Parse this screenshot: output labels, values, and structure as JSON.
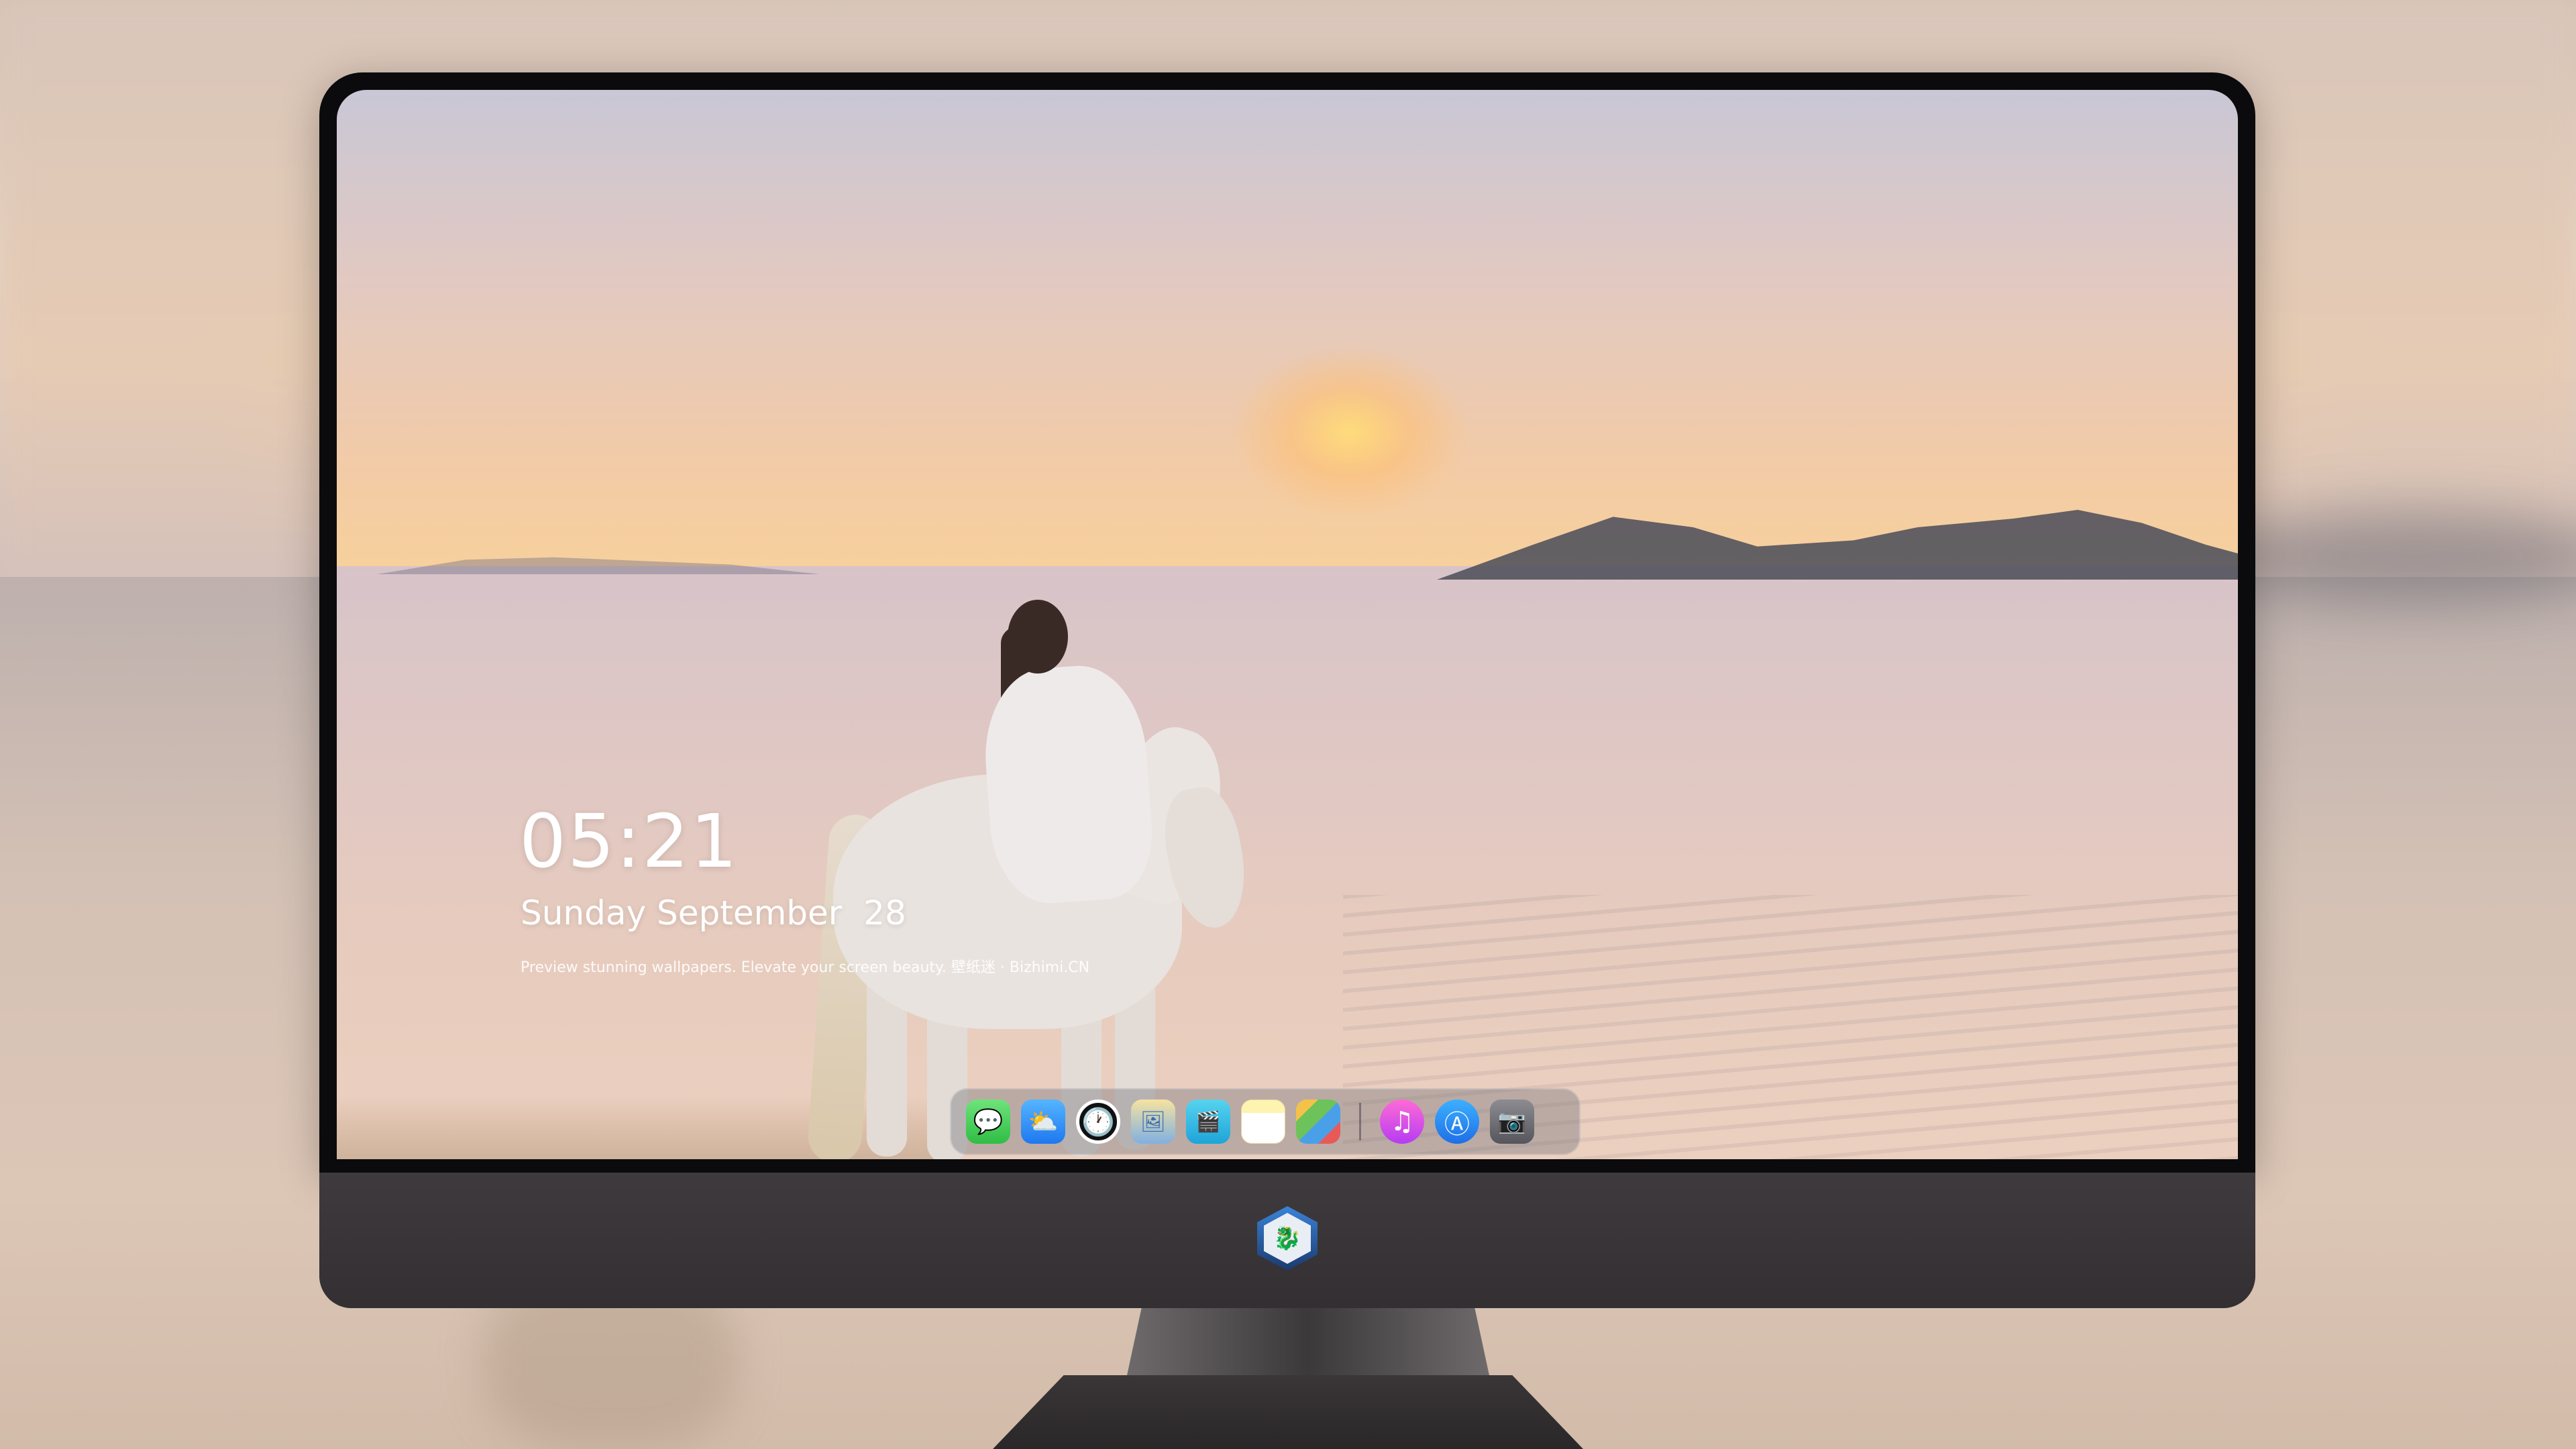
{
  "lockscreen": {
    "time": "05:21",
    "date": "Sunday September  28",
    "tagline": "Preview stunning wallpapers. Elevate your screen beauty. 壁纸迷 · Bizhimi.CN"
  },
  "dock": {
    "apps": [
      {
        "name": "Messages",
        "icon": "messages-icon",
        "glyph": "💬"
      },
      {
        "name": "Weather",
        "icon": "weather-icon",
        "glyph": "⛅"
      },
      {
        "name": "Clock",
        "icon": "clock-icon",
        "glyph": "🕐"
      },
      {
        "name": "Preview",
        "icon": "preview-icon",
        "glyph": "🖼"
      },
      {
        "name": "Clips",
        "icon": "clapperboard-icon",
        "glyph": "🎬"
      },
      {
        "name": "Notes",
        "icon": "notes-icon",
        "glyph": ""
      },
      {
        "name": "Photos",
        "icon": "photos-icon",
        "glyph": ""
      },
      {
        "name": "Music",
        "icon": "music-icon",
        "glyph": "♫"
      },
      {
        "name": "App Store",
        "icon": "app-store-icon",
        "glyph": "Ⓐ"
      },
      {
        "name": "Camera",
        "icon": "camera-icon",
        "glyph": "📷"
      }
    ]
  },
  "monitor": {
    "logo": "dragon-logo-icon",
    "logo_glyph": "🐉"
  }
}
